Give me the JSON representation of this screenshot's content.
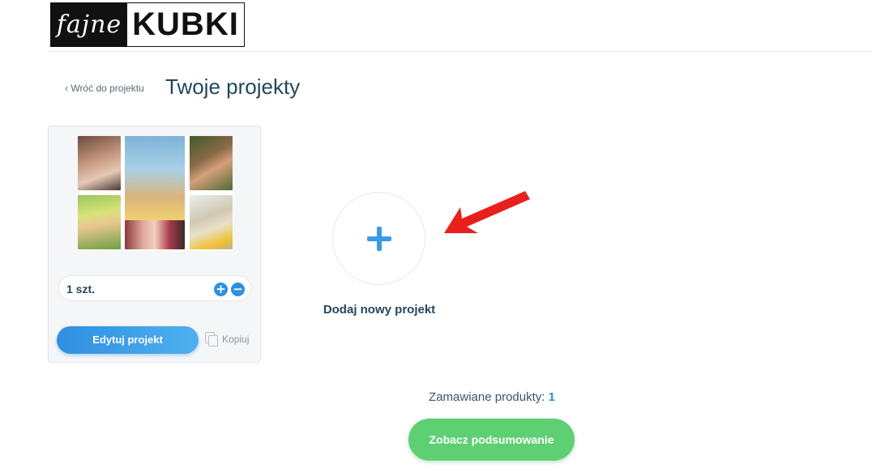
{
  "logo": {
    "script_text": "fajne",
    "bold_text": "KUBKI"
  },
  "header": {
    "back_link": "‹ Wróć do projektu",
    "title": "Twoje projekty"
  },
  "project_card": {
    "quantity": "1 szt.",
    "plus_symbol": "+",
    "minus_symbol": "−",
    "edit_label": "Edytuj projekt",
    "copy_label": "Kopiuj"
  },
  "add_project": {
    "label": "Dodaj nowy projekt"
  },
  "summary": {
    "ordered_label": "Zamawiane produkty:",
    "ordered_count": "1",
    "button_label": "Zobacz podsumowanie"
  },
  "colors": {
    "accent_blue": "#2f8fe0",
    "summary_green": "#5fcf74",
    "title_navy": "#22485e",
    "arrow_red": "#e8201c"
  },
  "icons": [
    "plus-icon",
    "minus-icon",
    "copy-icon",
    "red-arrow-icon"
  ]
}
